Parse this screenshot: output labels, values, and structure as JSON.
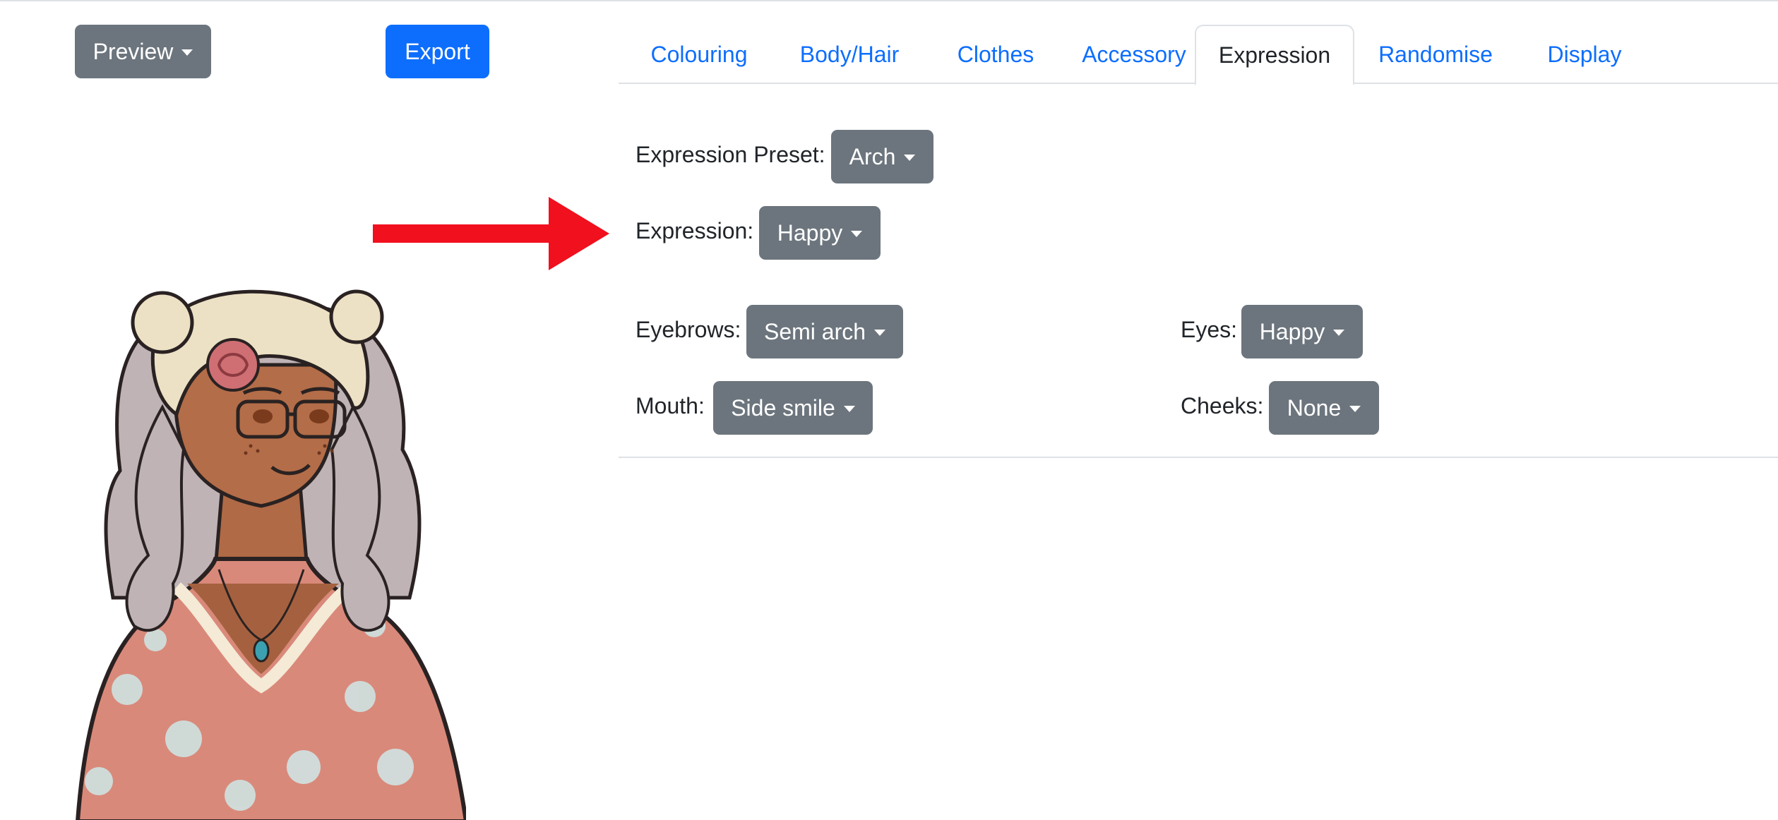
{
  "toolbar": {
    "preview_label": "Preview",
    "export_label": "Export"
  },
  "tabs": [
    {
      "label": "Colouring",
      "active": false
    },
    {
      "label": "Body/Hair",
      "active": false
    },
    {
      "label": "Clothes",
      "active": false
    },
    {
      "label": "Accessory",
      "active": false
    },
    {
      "label": "Expression",
      "active": true
    },
    {
      "label": "Randomise",
      "active": false
    },
    {
      "label": "Display",
      "active": false
    }
  ],
  "expression_panel": {
    "preset": {
      "label": "Expression Preset:",
      "value": "Arch"
    },
    "expression": {
      "label": "Expression:",
      "value": "Happy"
    },
    "eyebrows": {
      "label": "Eyebrows:",
      "value": "Semi arch"
    },
    "eyes": {
      "label": "Eyes:",
      "value": "Happy"
    },
    "mouth": {
      "label": "Mouth:",
      "value": "Side smile"
    },
    "cheeks": {
      "label": "Cheeks:",
      "value": "None"
    }
  },
  "colors": {
    "tab_link": "#0d6efd",
    "secondary_button": "#6c757d",
    "primary_button": "#0d6efd",
    "annotation_arrow": "#f0101e"
  },
  "icons": {
    "caret": "chevron-down-icon",
    "annotation": "red-arrow-icon"
  }
}
